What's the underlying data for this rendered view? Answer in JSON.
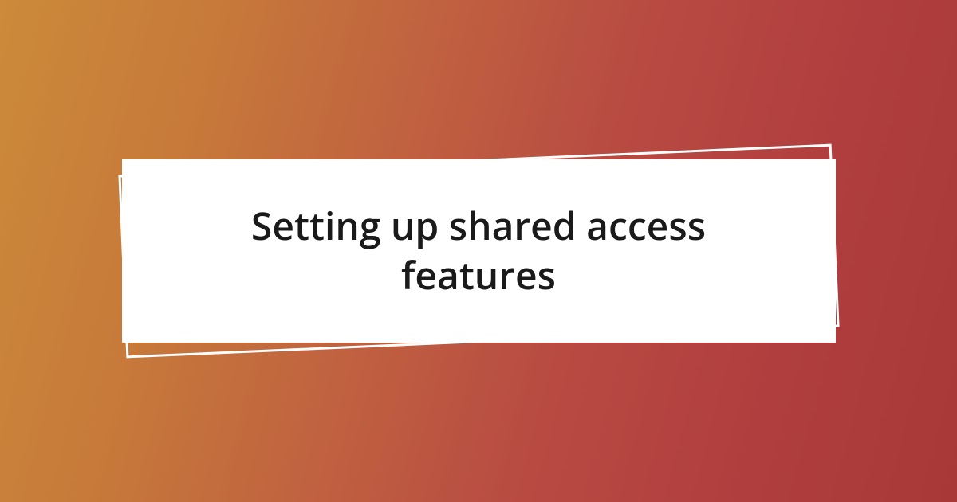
{
  "title": "Setting up shared access features",
  "colors": {
    "gradient_start": "#cc8a3a",
    "gradient_end": "#a83838",
    "card_background": "#ffffff",
    "outline_color": "#ffffff",
    "text_color": "#1a1a1a"
  }
}
